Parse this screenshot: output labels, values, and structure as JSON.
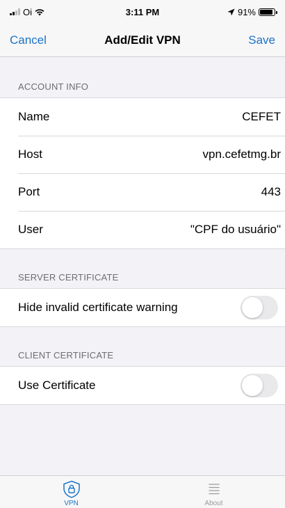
{
  "status_bar": {
    "carrier": "Oi",
    "time": "3:11 PM",
    "battery": "91%",
    "battery_level": 0.91
  },
  "nav": {
    "cancel_label": "Cancel",
    "title": "Add/Edit VPN",
    "save_label": "Save"
  },
  "account_info": {
    "header": "ACCOUNT INFO",
    "rows": [
      {
        "label": "Name",
        "value": "CEFET"
      },
      {
        "label": "Host",
        "value": "vpn.cefetmg.br"
      },
      {
        "label": "Port",
        "value": "443"
      },
      {
        "label": "User",
        "value": "\"CPF do usuário\""
      }
    ]
  },
  "server_certificate": {
    "header": "SERVER CERTIFICATE",
    "toggle_label": "Hide invalid certificate warning",
    "toggle_on": false
  },
  "client_certificate": {
    "header": "CLIENT CERTIFICATE",
    "toggle_label": "Use Certificate",
    "toggle_on": false
  },
  "tabs": [
    {
      "label": "VPN",
      "icon": "shield-lock-icon",
      "active": true
    },
    {
      "label": "About",
      "icon": "list-icon",
      "active": false
    }
  ],
  "colors": {
    "accent": "#1a73c8",
    "background": "#f2f2f7"
  }
}
